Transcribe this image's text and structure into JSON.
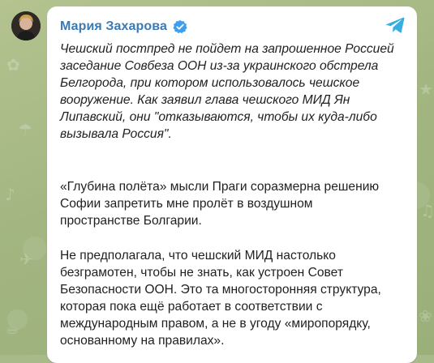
{
  "post": {
    "author": "Мария Захарова",
    "quote": "Чешский постпред не пойдет на запрошенное Россией\nзаседание Совбеза ООН из-за украинского обстрела\nБелгорода, при котором использовалось чешское\nвооружение. Как заявил глава чешского МИД Ян\nЛипавский, они \"отказываются, чтобы их куда-либо\nвызывала Россия\".",
    "paragraph_2": "«Глубина полёта» мысли Праги соразмерна решению\nСофии запретить мне пролёт в воздушном\nпространстве Болгарии.",
    "paragraph_3": "Не предполагала, что чешский МИД настолько\nбезграмотен, чтобы не знать, как устроен Совет\nБезопасности ООН. Это та многосторонняя структура,\nкоторая пока ещё работает в соответствии с\nмеждународным правом, а не в угоду «миропорядку,\nоснованному на правилах»."
  },
  "icons": {
    "verified": "verified-badge-icon",
    "telegram": "telegram-icon"
  },
  "colors": {
    "author": "#3c7ab4",
    "verified": "#3e9ef0",
    "telegram": "#37aee2",
    "background": "#a8b98a"
  }
}
